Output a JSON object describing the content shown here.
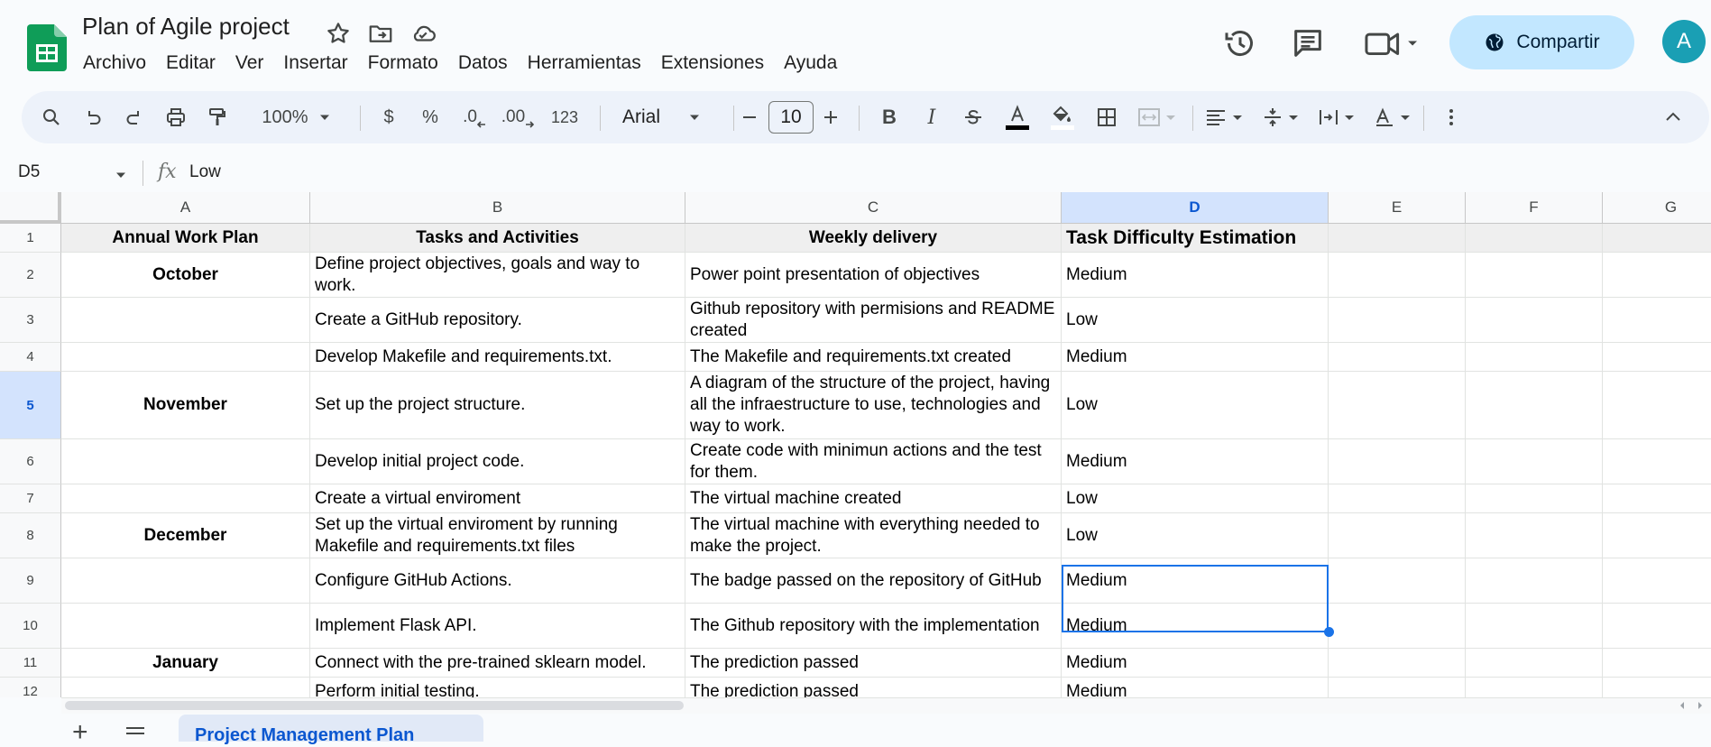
{
  "app": {
    "title": "Plan of Agile project",
    "brand_color": "#0f9d58",
    "accent_color": "#1a73e8",
    "share_label": "Compartir",
    "avatar_letter": "A"
  },
  "menu": [
    "Archivo",
    "Editar",
    "Ver",
    "Insertar",
    "Formato",
    "Datos",
    "Herramientas",
    "Extensiones",
    "Ayuda"
  ],
  "toolbar": {
    "zoom": "100%",
    "currency": "$",
    "percent": "%",
    "decrease_decimals": ".0",
    "increase_decimals": ".00",
    "more_formats": "123",
    "font": "Arial",
    "font_size": "10"
  },
  "formula_bar": {
    "cell_ref": "D5",
    "fx": "fx",
    "value": "Low"
  },
  "columns": [
    "A",
    "B",
    "C",
    "D",
    "E",
    "F",
    "G"
  ],
  "selected_cell": "D5",
  "rows": [
    {
      "num": "1",
      "a": "Annual Work Plan",
      "b": "Tasks and Activities",
      "c": "Weekly delivery",
      "d": "Task Difficulty Estimation"
    },
    {
      "num": "2",
      "a": "October",
      "b": "Define project objectives, goals and way to work.",
      "c": "Power point presentation of objectives",
      "d": "Medium"
    },
    {
      "num": "3",
      "a": "",
      "b": "Create a GitHub repository.",
      "c": "Github repository with permisions and README created",
      "d": "Low"
    },
    {
      "num": "4",
      "a": "",
      "b": "Develop Makefile and requirements.txt.",
      "c": "The Makefile and requirements.txt created",
      "d": "Medium"
    },
    {
      "num": "5",
      "a": "November",
      "b": "Set up the project structure.",
      "c": "A diagram of the structure of the project, having all the infraestructure to use, technologies and way to work.",
      "d": "Low"
    },
    {
      "num": "6",
      "a": "",
      "b": "Develop initial project code.",
      "c": "Create code with minimun actions and the test for them.",
      "d": "Medium"
    },
    {
      "num": "7",
      "a": "",
      "b": "Create a virtual enviroment",
      "c": "The virtual machine created",
      "d": "Low"
    },
    {
      "num": "8",
      "a": "December",
      "b": "Set up the virtual enviroment by running Makefile and requirements.txt files",
      "c": "The virtual machine with everything needed to make the project.",
      "d": "Low"
    },
    {
      "num": "9",
      "a": "",
      "b": "Configure GitHub Actions.",
      "c": "The badge passed on the repository of GitHub",
      "d": "Medium"
    },
    {
      "num": "10",
      "a": "",
      "b": "Implement Flask API.",
      "c": "The Github repository with the implementation",
      "d": "Medium"
    },
    {
      "num": "11",
      "a": "January",
      "b": "Connect with the pre-trained sklearn model.",
      "c": "The prediction passed",
      "d": "Medium"
    },
    {
      "num": "12",
      "a": "",
      "b": "Perform initial testing.",
      "c": "The prediction passed",
      "d": "Medium"
    }
  ],
  "sheet_tab": "Project Management Plan"
}
